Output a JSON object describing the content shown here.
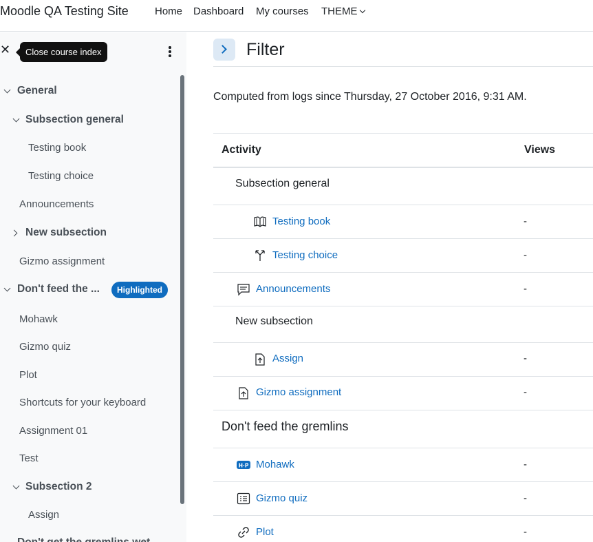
{
  "navbar": {
    "site_name": "Moodle QA Testing Site",
    "links": [
      "Home",
      "Dashboard",
      "My courses",
      "THEME"
    ]
  },
  "drawer": {
    "tooltip": "Close course index",
    "badge": "Highlighted",
    "items": [
      {
        "label": "General",
        "kind": "section",
        "expanded": true
      },
      {
        "label": "Subsection general",
        "kind": "subsection",
        "expanded": true
      },
      {
        "label": "Testing book",
        "kind": "activity"
      },
      {
        "label": "Testing choice",
        "kind": "activity"
      },
      {
        "label": "Announcements",
        "kind": "activity"
      },
      {
        "label": "New subsection",
        "kind": "subsection",
        "expanded": false
      },
      {
        "label": "Gizmo assignment",
        "kind": "activity"
      },
      {
        "label": "Don't feed the ...",
        "kind": "section",
        "expanded": true,
        "highlighted": true
      },
      {
        "label": "Mohawk",
        "kind": "activity"
      },
      {
        "label": "Gizmo quiz",
        "kind": "activity"
      },
      {
        "label": "Plot",
        "kind": "activity"
      },
      {
        "label": "Shortcuts for your keyboard",
        "kind": "activity"
      },
      {
        "label": "Assignment 01",
        "kind": "activity"
      },
      {
        "label": "Test",
        "kind": "activity"
      },
      {
        "label": "Subsection 2",
        "kind": "subsection",
        "expanded": true
      },
      {
        "label": "Assign",
        "kind": "activity"
      },
      {
        "label": "Don't get the gremlins wet",
        "kind": "section"
      }
    ]
  },
  "main": {
    "title": "Filter",
    "computed_text": "Computed from logs since Thursday, 27 October 2016, 9:31 AM.",
    "table": {
      "headers": [
        "Activity",
        "Views"
      ],
      "rows": [
        {
          "type": "subsection",
          "label": "Subsection general"
        },
        {
          "type": "activity",
          "label": "Testing book",
          "icon": "book-icon",
          "views": "-"
        },
        {
          "type": "activity",
          "label": "Testing choice",
          "icon": "choice-icon",
          "views": "-"
        },
        {
          "type": "activity",
          "label": "Announcements",
          "icon": "forum-icon",
          "views": "-"
        },
        {
          "type": "subsection",
          "label": "New subsection"
        },
        {
          "type": "activity",
          "label": "Assign",
          "icon": "assign-icon",
          "views": "-"
        },
        {
          "type": "activity",
          "label": "Gizmo assignment",
          "icon": "assign-icon",
          "views": "-"
        },
        {
          "type": "section",
          "label": "Don't feed the gremlins"
        },
        {
          "type": "activity",
          "label": "Mohawk",
          "icon": "h5p-icon",
          "views": "-"
        },
        {
          "type": "activity",
          "label": "Gizmo quiz",
          "icon": "quiz-icon",
          "views": "-"
        },
        {
          "type": "activity",
          "label": "Plot",
          "icon": "link-icon",
          "views": "-"
        }
      ]
    }
  },
  "colors": {
    "link": "#0f6cbf",
    "badge": "#0f6cbf",
    "drawer_bg": "#f8f9fa",
    "tooltip_bg": "#111111"
  }
}
